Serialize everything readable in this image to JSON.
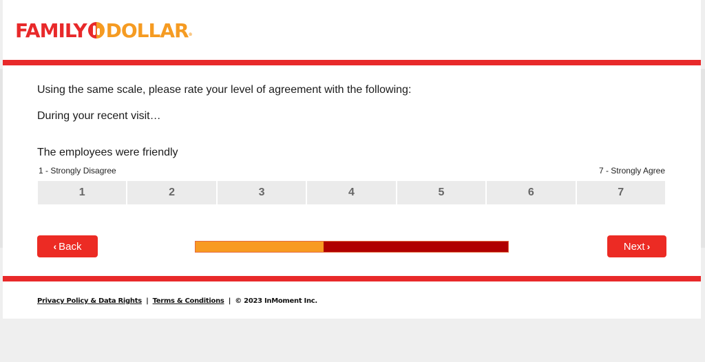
{
  "brand": {
    "name_part1": "FAMILY",
    "name_part2": "DOLLAR",
    "primary_color": "#e8292a",
    "secondary_color": "#f59b22"
  },
  "survey": {
    "intro": "Using the same scale, please rate your level of agreement with the following:",
    "sub": "During your recent visit…",
    "item": "The employees were friendly",
    "anchor_low": "1 - Strongly Disagree",
    "anchor_high": "7 - Strongly Agree",
    "options": [
      "1",
      "2",
      "3",
      "4",
      "5",
      "6",
      "7"
    ],
    "selected": null
  },
  "navigation": {
    "back_label": "Back",
    "back_icon": "chevron-left-icon",
    "next_label": "Next",
    "next_icon": "chevron-right-icon"
  },
  "progress": {
    "fraction": 0.41,
    "fill_color": "#f89a22",
    "track_color": "#b00000"
  },
  "footer": {
    "privacy_link": "Privacy Policy & Data Rights",
    "terms_link": "Terms & Conditions",
    "separator": "|",
    "copyright": "© 2023 InMoment Inc."
  }
}
